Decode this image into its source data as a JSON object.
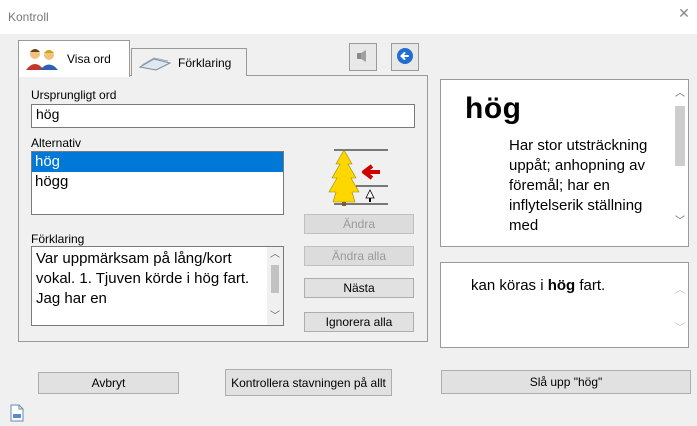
{
  "window": {
    "title": "Kontroll",
    "close_symbol": "✕"
  },
  "tabs": [
    {
      "label": "Visa ord",
      "icon": "people-icon",
      "active": true
    },
    {
      "label": "Förklaring",
      "icon": "book-icon",
      "active": false
    }
  ],
  "toolbar": {
    "speaker_icon": "speaker-icon",
    "back_icon": "back-arrow-icon"
  },
  "original_word": {
    "label": "Ursprungligt ord",
    "value": "hög"
  },
  "alternatives": {
    "label": "Alternativ",
    "items": [
      "hög",
      "högg"
    ],
    "selected_index": 0
  },
  "explanation": {
    "label": "Förklaring",
    "text": "Var uppmärksam på lång/kort vokal. 1. Tjuven körde i hög fart. Jag har en"
  },
  "actions": {
    "change": "Ändra",
    "change_all": "Ändra alla",
    "next": "Nästa",
    "ignore_all": "Ignorera alla"
  },
  "dictionary": {
    "headword": "hög",
    "definition": "Har stor utsträckning uppåt; anhopning av föremål; har en inflytelserik ställning med"
  },
  "example": {
    "before": "kan köras i ",
    "bold": "hög",
    "after": " fart."
  },
  "bottom": {
    "cancel": "Avbryt",
    "check_all": "Kontrollera stavningen på allt",
    "lookup": "Slå upp \"hög\""
  }
}
